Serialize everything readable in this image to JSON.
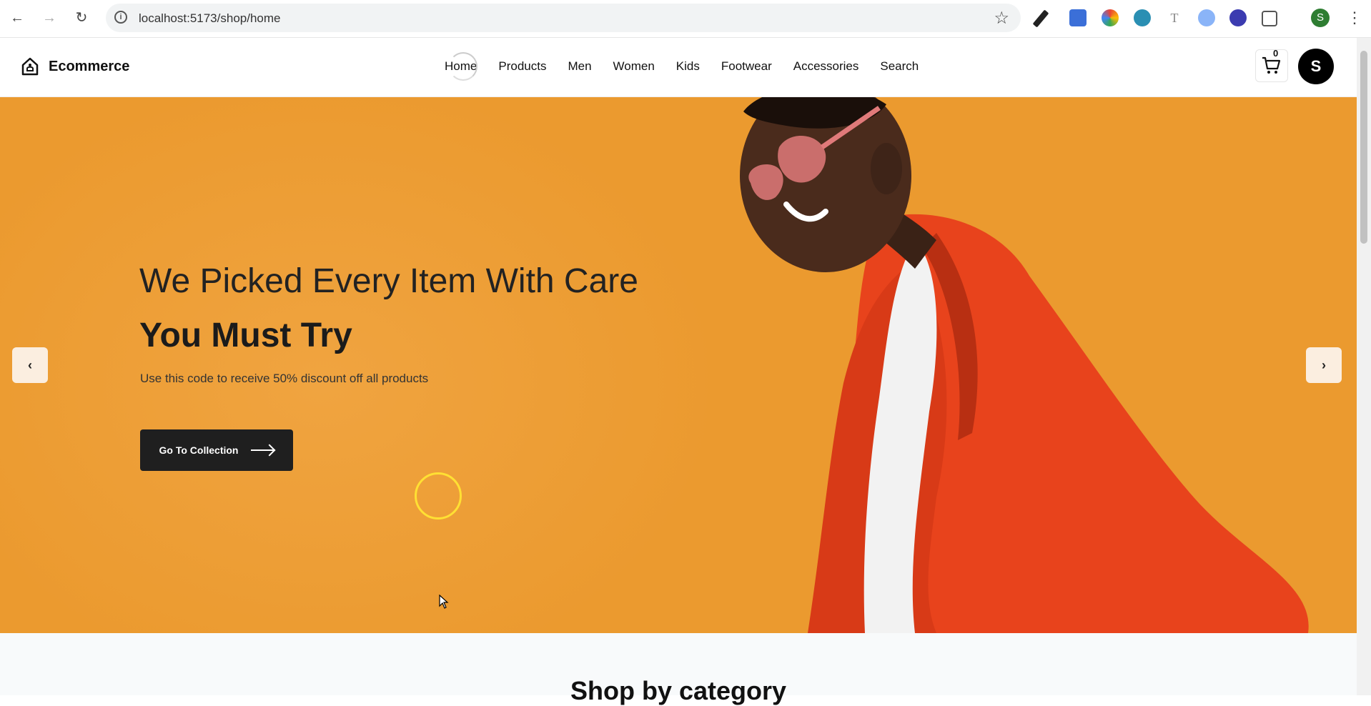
{
  "browser": {
    "url": "localhost:5173/shop/home",
    "profile_initial": "S"
  },
  "site": {
    "brand": "Ecommerce",
    "nav": [
      "Home",
      "Products",
      "Men",
      "Women",
      "Kids",
      "Footwear",
      "Accessories",
      "Search"
    ],
    "active_nav": "Home",
    "cart_count": "0",
    "user_initial": "S"
  },
  "hero": {
    "title": "We Picked Every Item With Care",
    "subtitle": "You Must Try",
    "description": "Use this code to receive 50% discount off all products",
    "cta_label": "Go To Collection",
    "prev_label": "‹",
    "next_label": "›",
    "background_color": "#eb9a2f"
  },
  "section": {
    "title": "Shop by category"
  }
}
